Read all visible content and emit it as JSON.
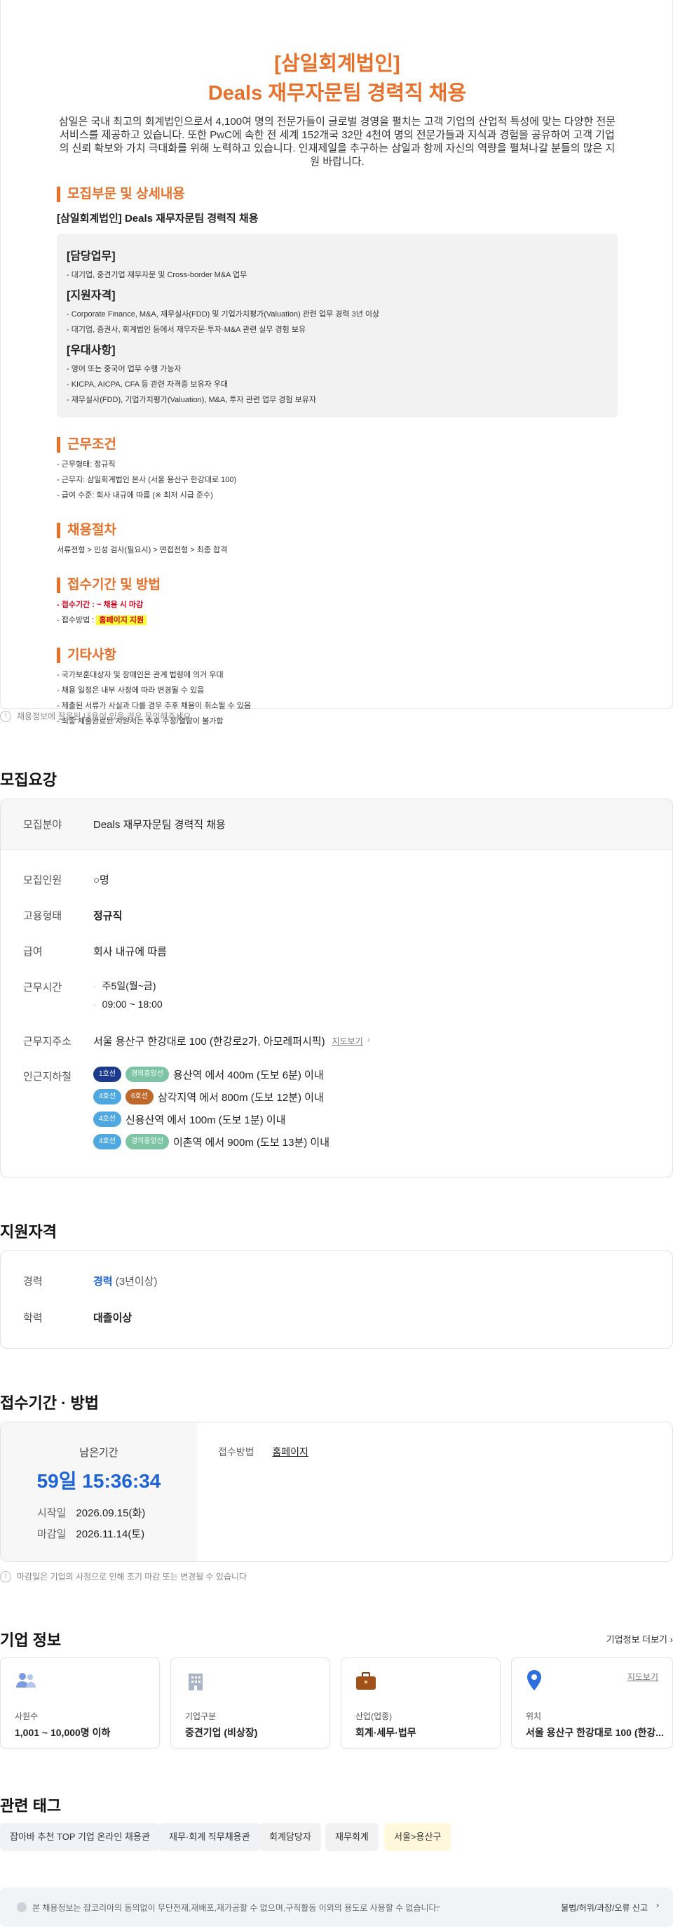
{
  "header": {
    "company": "[삼일회계법인]",
    "title": "Deals 재무자문팀 경력직 채용",
    "intro": "삼일은 국내 최고의 회계법인으로서 4,100여 명의 전문가들이 글로벌 경영을 펼치는 고객 기업의 산업적 특성에 맞는 다양한 전문 서비스를 제공하고 있습니다. 또한 PwC에 속한 전 세계 152개국 32만 4천여 명의 전문가들과 지식과 경험을 공유하여 고객 기업의 신뢰 확보와 가치 극대화를 위해 노력하고 있습니다. 인재제일을 추구하는 삼일과 함께 자신의 역량을 펼쳐나갈 분들의 많은 지원 바랍니다."
  },
  "detail": {
    "section1_title": "모집부문 및 상세내용",
    "section1_sub": "[삼일회계법인] Deals 재무자문팀 경력직 채용",
    "duties_title": "[담당업무]",
    "duties": [
      "- 대기업, 중견기업 재무자문 및 Cross-border M&A 업무"
    ],
    "qual_title": "[지원자격]",
    "quals": [
      "- Corporate Finance, M&A, 재무실사(FDD) 및 기업가치평가(Valuation) 관련 업무 경력 3년 이상",
      "- 대기업, 증권사, 회계법인 등에서 재무자문·투자·M&A 관련 실무 경험 보유"
    ],
    "pref_title": "[우대사항]",
    "prefs": [
      "- 영어 또는 중국어 업무 수행 가능자",
      "- KICPA, AICPA, CFA 등 관련 자격증 보유자 우대",
      "- 재무실사(FDD), 기업가치평가(Valuation), M&A, 투자 관련 업무 경험 보유자"
    ],
    "section2_title": "근무조건",
    "conditions": [
      "- 근무형태: 정규직",
      "- 근무지: 삼일회계법인 본사 (서울 용산구 한강대로 100)",
      "- 급여 수준: 회사 내규에 따름 (※ 최저 시급 준수)"
    ],
    "section3_title": "채용절차",
    "process": "서류전형 > 인성 검사(필요시) > 면접전형 > 최종 합격",
    "section4_title": "접수기간 및 방법",
    "period_label": "- 접수기간 : ~ 채용 시 마감",
    "method_prefix": "- 접수방법 : ",
    "method_value": "홈페이지 지원",
    "section5_title": "기타사항",
    "etc": [
      "- 국가보훈대상자 및 장애인은 관계 법령에 의거 우대",
      "- 채용 일정은 내부 사정에 따라 변경될 수 있음",
      "- 제출된 서류가 사실과 다를 경우 추후 채용이 취소될 수 있음",
      "- 최종 제출완료된 지원서는 추후 수정/열람이 불가함"
    ],
    "report_notice": "채용정보에 잘못된 내용이 있을 경우 문의해주세요."
  },
  "summary": {
    "title": "모집요강",
    "field_label": "모집분야",
    "field_value": "Deals 재무자문팀 경력직 채용",
    "headcount_label": "모집인원",
    "headcount_value": "○명",
    "type_label": "고용형태",
    "type_value": "정규직",
    "salary_label": "급여",
    "salary_value": "회사 내규에 따름",
    "hours_label": "근무시간",
    "hours": [
      "주5일(월~금)",
      "09:00 ~ 18:00"
    ],
    "address_label": "근무지주소",
    "address_value": "서울 용산구 한강대로 100 (한강로2가, 아모레퍼시픽)",
    "map_link": "지도보기",
    "subway_label": "인근지하철",
    "stations": [
      {
        "badges": [
          {
            "text": "1호선",
            "color": "#1d3b8c"
          },
          {
            "text": "경의중앙선",
            "color": "#7cc4a4"
          }
        ],
        "text": "용산역 에서 400m (도보 6분) 이내"
      },
      {
        "badges": [
          {
            "text": "4호선",
            "color": "#4fa8e0"
          },
          {
            "text": "6호선",
            "color": "#c0672c"
          }
        ],
        "text": "삼각지역 에서 800m (도보 12분) 이내"
      },
      {
        "badges": [
          {
            "text": "4호선",
            "color": "#4fa8e0"
          }
        ],
        "text": "신용산역 에서 100m (도보 1분) 이내"
      },
      {
        "badges": [
          {
            "text": "4호선",
            "color": "#4fa8e0"
          },
          {
            "text": "경의중앙선",
            "color": "#7cc4a4"
          }
        ],
        "text": "이촌역 에서 900m (도보 13분) 이내"
      }
    ]
  },
  "qualification": {
    "title": "지원자격",
    "career_label": "경력",
    "career_value": "경력",
    "career_extra": " (3년이상)",
    "edu_label": "학력",
    "edu_value": "대졸이상"
  },
  "apply": {
    "title": "접수기간 · 방법",
    "remaining_label": "남은기간",
    "remaining_value": "59일 15:36:34",
    "start_label": "시작일",
    "start_value": "2026.09.15(화)",
    "end_label": "마감일",
    "end_value": "2026.11.14(토)",
    "method_label": "접수방법",
    "method_value": "홈페이지",
    "notice": "마감일은 기업의 사정으로 인해 조기 마감 또는 변경될 수 있습니다"
  },
  "company": {
    "title": "기업 정보",
    "more": "기업정보 더보기",
    "cards": [
      {
        "icon": "people-icon",
        "label": "사원수",
        "value": "1,001 ~ 10,000명 이하"
      },
      {
        "icon": "building-icon",
        "label": "기업구분",
        "value": "중견기업 (비상장)"
      },
      {
        "icon": "briefcase-icon",
        "label": "산업(업종)",
        "value": "회계·세무·법무"
      },
      {
        "icon": "location-pin-icon",
        "label": "위치",
        "value": "서울 용산구 한강대로 100 (한강...",
        "link": "지도보기"
      }
    ]
  },
  "tags": {
    "title": "관련 태그",
    "items": [
      "잡아바 추천 TOP 기업 온라인 채용관",
      "재무·회계 직무채용관",
      "회계담당자",
      "재무회계",
      "서울>용산구"
    ]
  },
  "footer": {
    "text": "본 채용정보는 잡코리아의 동의없이 무단전재,재배포,재가공할 수 없으며,구직활동 이외의 용도로 사용할 수 없습니다.",
    "report": "불법/허위/과장/오류 신고"
  },
  "colors": {
    "accent": "#e8702a",
    "blue": "#1d63d8",
    "red": "#d8001c"
  }
}
